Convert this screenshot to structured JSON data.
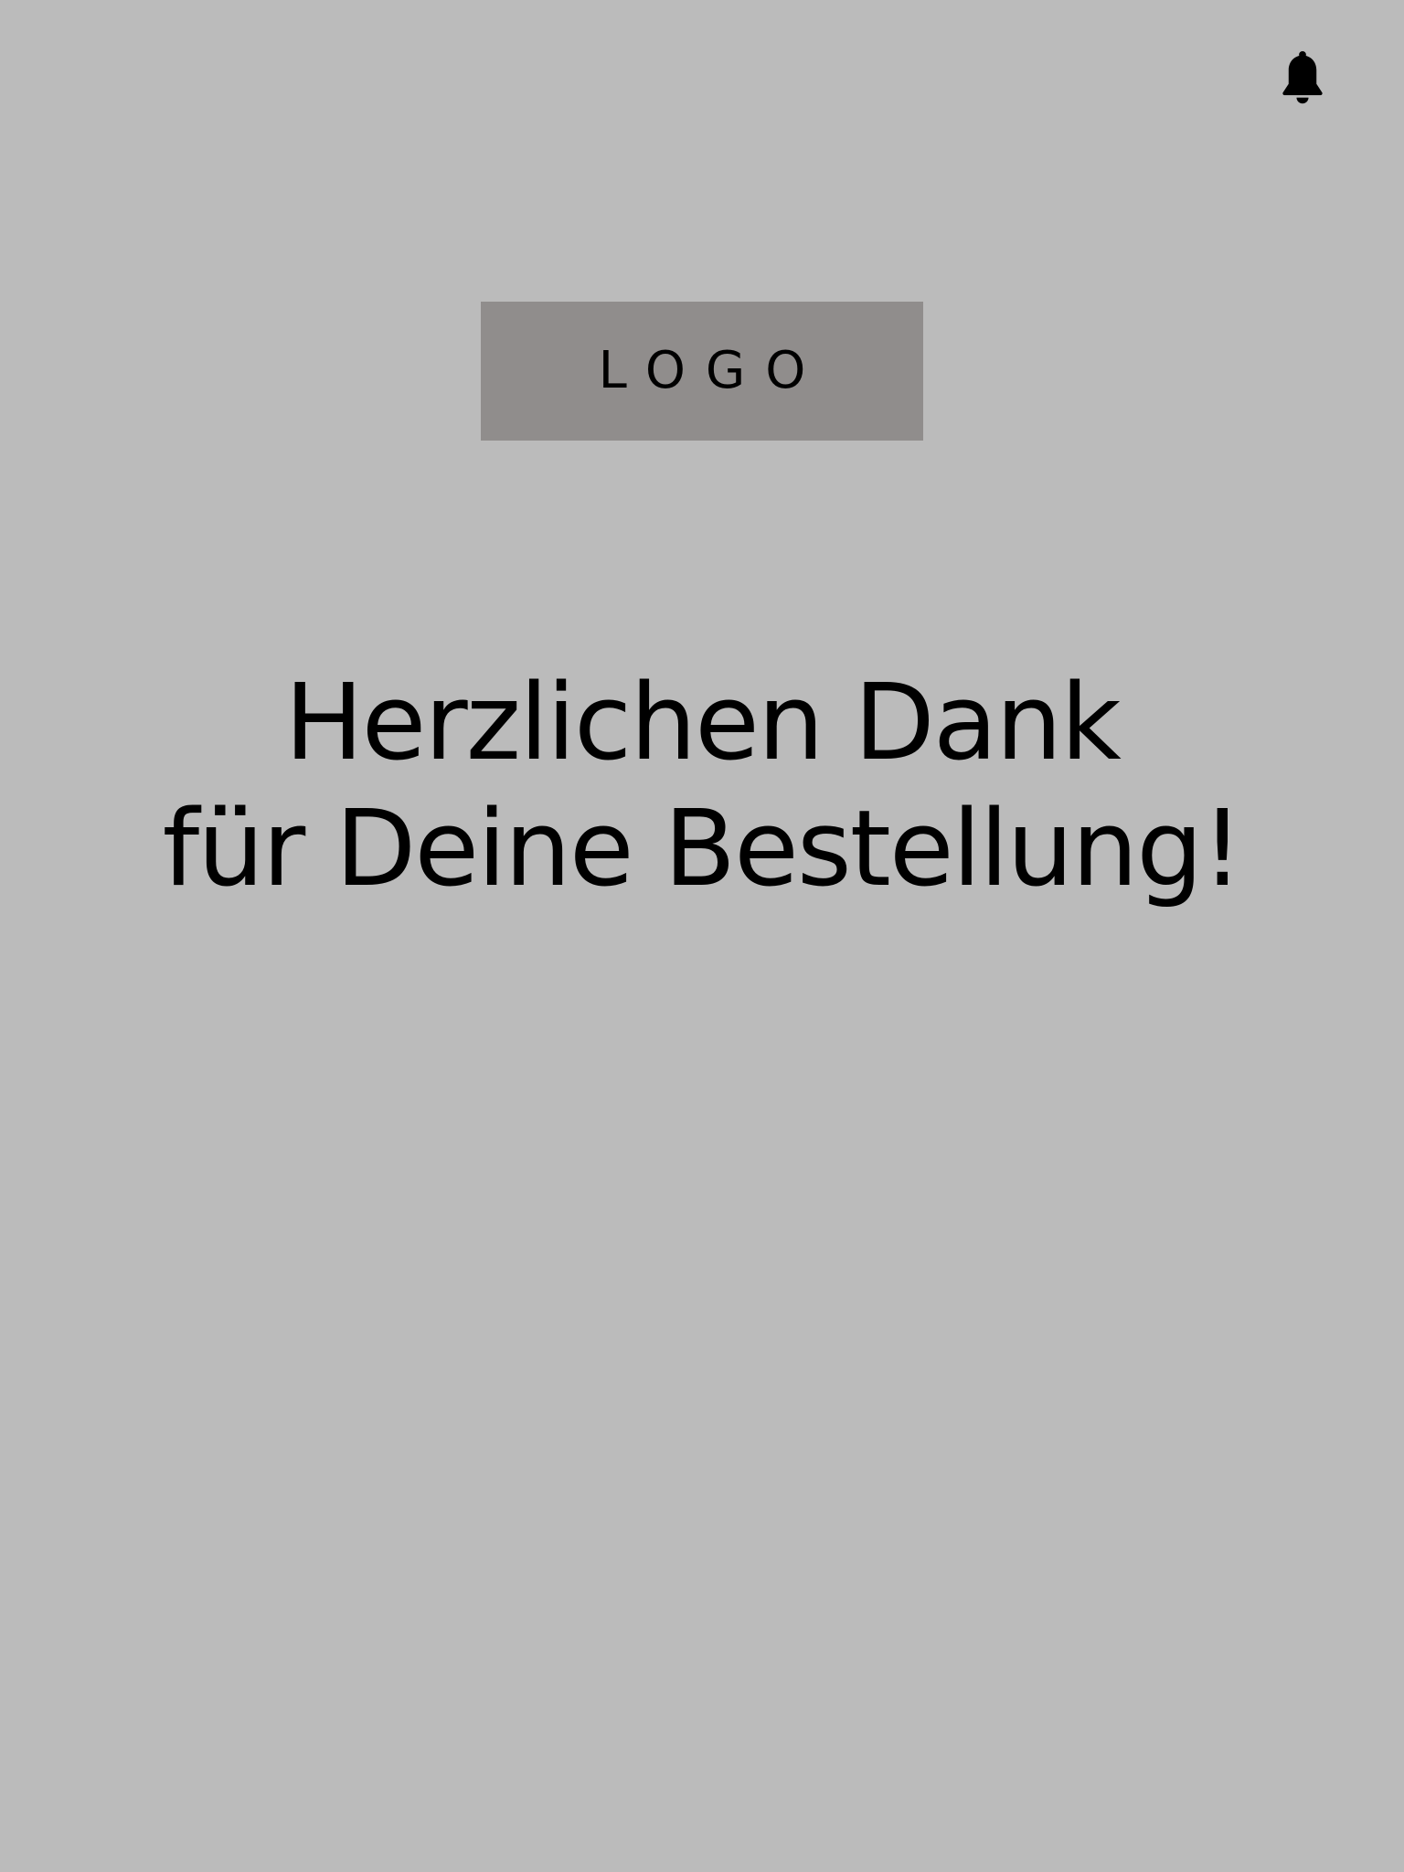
{
  "header": {
    "notification_icon": "bell-icon"
  },
  "logo": {
    "text": "LOGO"
  },
  "main": {
    "title_line1": "Herzlichen Dank",
    "title_line2": "für Deine Bestellung!"
  },
  "colors": {
    "background": "#bbbbbb",
    "logo_background": "#908d8c",
    "text": "#000000"
  }
}
